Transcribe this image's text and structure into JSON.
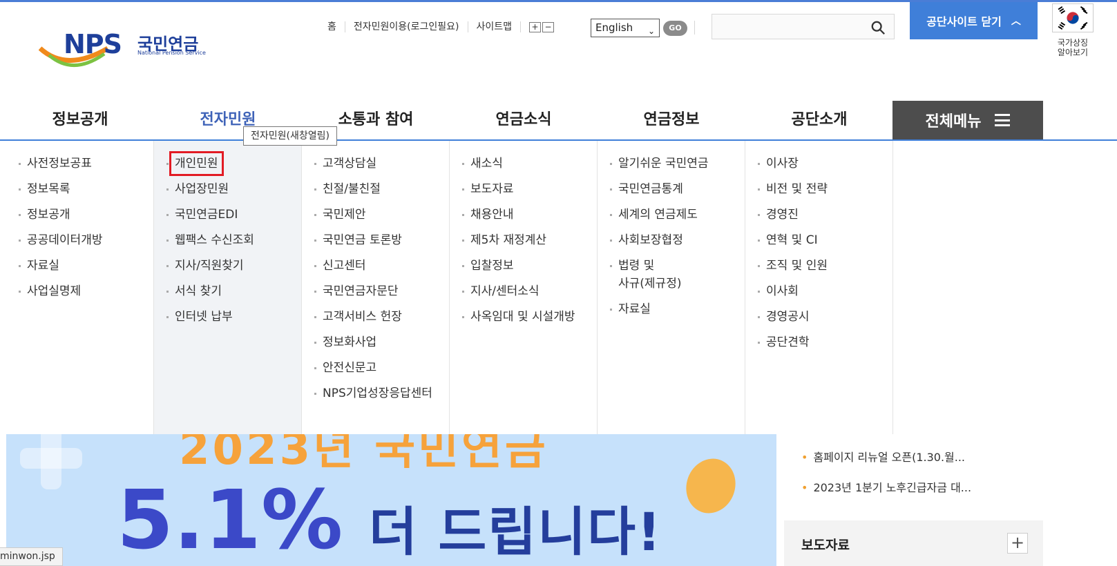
{
  "logo": {
    "text": "NPS",
    "korean": "국민연금",
    "english": "National Pension Service"
  },
  "util": {
    "links": [
      "홈",
      "전자민원이용(로그인필요)",
      "사이트맵"
    ],
    "zoom_in": "+",
    "zoom_out": "−",
    "language": "English",
    "go": "GO",
    "search_placeholder": ""
  },
  "close_site_label": "공단사이트 닫기",
  "flag_label_1": "국가상징",
  "flag_label_2": "알아보기",
  "gnb": [
    "정보공개",
    "전자민원",
    "소통과 참여",
    "연금소식",
    "연금정보",
    "공단소개"
  ],
  "all_menu": "전체메뉴",
  "tooltip": "전자민원(새창열림)",
  "mega": [
    [
      "사전정보공표",
      "정보목록",
      "정보공개",
      "공공데이터개방",
      "자료실",
      "사업실명제"
    ],
    [
      "개인민원",
      "사업장민원",
      "국민연금EDI",
      "웹팩스 수신조회",
      "지사/직원찾기",
      "서식 찾기",
      "인터넷 납부"
    ],
    [
      "고객상담실",
      "친절/불친절",
      "국민제안",
      "국민연금 토론방",
      "신고센터",
      "국민연금자문단",
      "고객서비스 헌장",
      "정보화사업",
      "안전신문고",
      "NPS기업성장응답센터"
    ],
    [
      "새소식",
      "보도자료",
      "채용안내",
      "제5차 재정계산",
      "입찰정보",
      "지사/센터소식",
      "사옥임대 및 시설개방"
    ],
    [
      "알기쉬운 국민연금",
      "국민연금통계",
      "세계의 연금제도",
      "사회보장협정",
      "법령 및",
      "사규(제규정)",
      "자료실"
    ],
    [
      "이사장",
      "비전 및 전략",
      "경영진",
      "연혁 및 CI",
      "조직 및 인원",
      "이사회",
      "경영공시",
      "공단견학"
    ]
  ],
  "banner": {
    "top": "2023년 국민연금",
    "big": "5.1%",
    "sub": "더 드립니다!"
  },
  "news": [
    "홈페이지 리뉴얼 오픈(1.30.월...",
    "2023년 1분기 노후긴급자금 대..."
  ],
  "press_title": "보도자료",
  "press_more": "+",
  "status_url": "minwon.jsp"
}
